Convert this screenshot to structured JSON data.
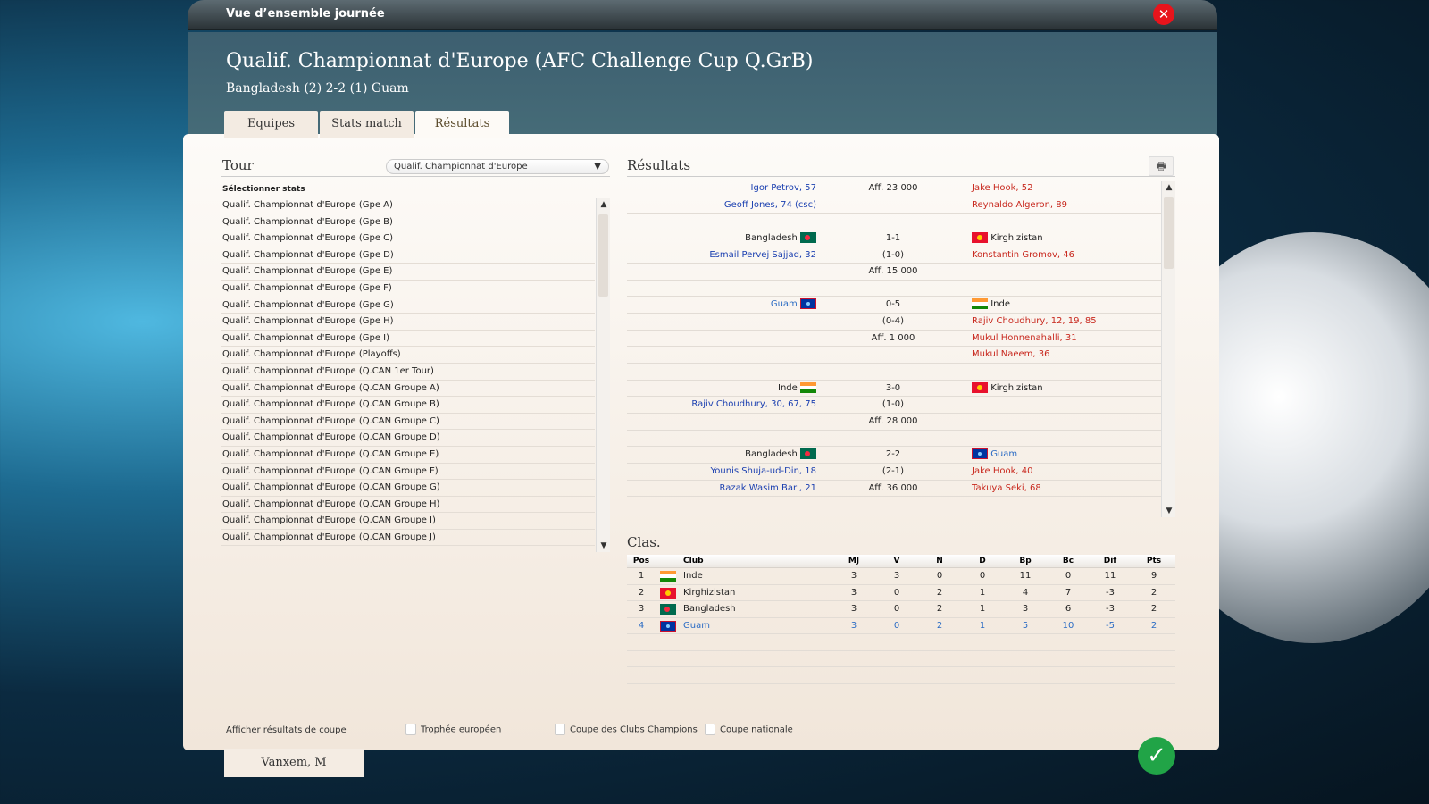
{
  "window": {
    "title": "Vue d’ensemble journée"
  },
  "header": {
    "title": "Qualif. Championnat d'Europe (AFC Challenge Cup Q.GrB)",
    "subtitle": "Bangladesh (2) 2-2 (1) Guam"
  },
  "tabs": [
    {
      "label": "Equipes"
    },
    {
      "label": "Stats match"
    },
    {
      "label": "Résultats",
      "active": true
    }
  ],
  "tour": {
    "label": "Tour",
    "selected": "Qualif. Championnat d'Europe",
    "stats_label": "Sélectionner stats",
    "items": [
      "Qualif. Championnat d'Europe (Gpe A)",
      "Qualif. Championnat d'Europe (Gpe B)",
      "Qualif. Championnat d'Europe (Gpe C)",
      "Qualif. Championnat d'Europe (Gpe D)",
      "Qualif. Championnat d'Europe (Gpe E)",
      "Qualif. Championnat d'Europe (Gpe F)",
      "Qualif. Championnat d'Europe (Gpe G)",
      "Qualif. Championnat d'Europe (Gpe H)",
      "Qualif. Championnat d'Europe (Gpe I)",
      "Qualif. Championnat d'Europe (Playoffs)",
      "Qualif. Championnat d'Europe (Q.CAN 1er Tour)",
      "Qualif. Championnat d'Europe (Q.CAN Groupe A)",
      "Qualif. Championnat d'Europe (Q.CAN Groupe B)",
      "Qualif. Championnat d'Europe (Q.CAN Groupe C)",
      "Qualif. Championnat d'Europe (Q.CAN Groupe D)",
      "Qualif. Championnat d'Europe (Q.CAN Groupe E)",
      "Qualif. Championnat d'Europe (Q.CAN Groupe F)",
      "Qualif. Championnat d'Europe (Q.CAN Groupe G)",
      "Qualif. Championnat d'Europe (Q.CAN Groupe H)",
      "Qualif. Championnat d'Europe (Q.CAN Groupe I)",
      "Qualif. Championnat d'Europe (Q.CAN Groupe J)"
    ]
  },
  "results": {
    "label": "Résultats",
    "print_icon": "printer-icon",
    "rows": [
      {
        "l": "Igor Petrov, 57",
        "lc": "blue",
        "c": "Aff. 23 000",
        "r": "Jake Hook, 52",
        "rc": "red"
      },
      {
        "l": "Geoff Jones, 74 (csc)",
        "lc": "blue",
        "c": "",
        "r": "Reynaldo Algeron, 89",
        "rc": "red"
      },
      {
        "l": "",
        "c": "",
        "r": ""
      },
      {
        "l": "Bangladesh",
        "lc": "dark",
        "lf": "bd",
        "c": "1-1",
        "r": "Kirghizistan",
        "rc": "dark",
        "rf": "kg"
      },
      {
        "l": "Esmail Pervej Sajjad, 32",
        "lc": "blue",
        "c": "(1-0)",
        "r": "Konstantin Gromov, 46",
        "rc": "red"
      },
      {
        "l": "",
        "c": "Aff. 15 000",
        "r": ""
      },
      {
        "l": "",
        "c": "",
        "r": ""
      },
      {
        "l": "Guam",
        "lc": "lblue",
        "lf": "gu",
        "c": "0-5",
        "r": "Inde",
        "rc": "dark",
        "rf": "in"
      },
      {
        "l": "",
        "c": "(0-4)",
        "r": "Rajiv Choudhury, 12, 19, 85",
        "rc": "red"
      },
      {
        "l": "",
        "c": "Aff. 1 000",
        "r": "Mukul Honnenahalli, 31",
        "rc": "red"
      },
      {
        "l": "",
        "c": "",
        "r": "Mukul Naeem, 36",
        "rc": "red"
      },
      {
        "l": "",
        "c": "",
        "r": ""
      },
      {
        "l": "Inde",
        "lc": "dark",
        "lf": "in",
        "c": "3-0",
        "r": "Kirghizistan",
        "rc": "dark",
        "rf": "kg"
      },
      {
        "l": "Rajiv Choudhury, 30, 67, 75",
        "lc": "blue",
        "c": "(1-0)",
        "r": ""
      },
      {
        "l": "",
        "c": "Aff. 28 000",
        "r": ""
      },
      {
        "l": "",
        "c": "",
        "r": ""
      },
      {
        "l": "Bangladesh",
        "lc": "dark",
        "lf": "bd",
        "c": "2-2",
        "r": "Guam",
        "rc": "lblue",
        "rf": "gu"
      },
      {
        "l": "Younis Shuja-ud-Din, 18",
        "lc": "blue",
        "c": "(2-1)",
        "r": "Jake Hook, 40",
        "rc": "red"
      },
      {
        "l": "Razak Wasim Bari, 21",
        "lc": "blue",
        "c": "Aff. 36 000",
        "r": "Takuya Seki, 68",
        "rc": "red"
      }
    ]
  },
  "standings": {
    "label": "Clas.",
    "columns": [
      "Pos",
      "",
      "Club",
      "MJ",
      "V",
      "N",
      "D",
      "Bp",
      "Bc",
      "Dif",
      "Pts"
    ],
    "rows": [
      {
        "pos": "1",
        "flag": "in",
        "club": "Inde",
        "v": [
          "3",
          "3",
          "0",
          "0",
          "11",
          "0",
          "11",
          "9"
        ]
      },
      {
        "pos": "2",
        "flag": "kg",
        "club": "Kirghizistan",
        "v": [
          "3",
          "0",
          "2",
          "1",
          "4",
          "7",
          "-3",
          "2"
        ]
      },
      {
        "pos": "3",
        "flag": "bd",
        "club": "Bangladesh",
        "v": [
          "3",
          "0",
          "2",
          "1",
          "3",
          "6",
          "-3",
          "2"
        ]
      },
      {
        "pos": "4",
        "flag": "gu",
        "club": "Guam",
        "v": [
          "3",
          "0",
          "2",
          "1",
          "5",
          "10",
          "-5",
          "2"
        ],
        "highlight": true
      }
    ]
  },
  "footer": {
    "cup_label": "Afficher résultats de coupe",
    "checkboxes": [
      "Trophée européen",
      "Coupe des Clubs Champions",
      "Coupe nationale"
    ],
    "manager": "Vanxem, M"
  },
  "colors": {
    "accent_blue": "#1a3fb0",
    "scorer_red": "#c8281e",
    "ok_green": "#21a447",
    "close_red": "#e8141c"
  }
}
